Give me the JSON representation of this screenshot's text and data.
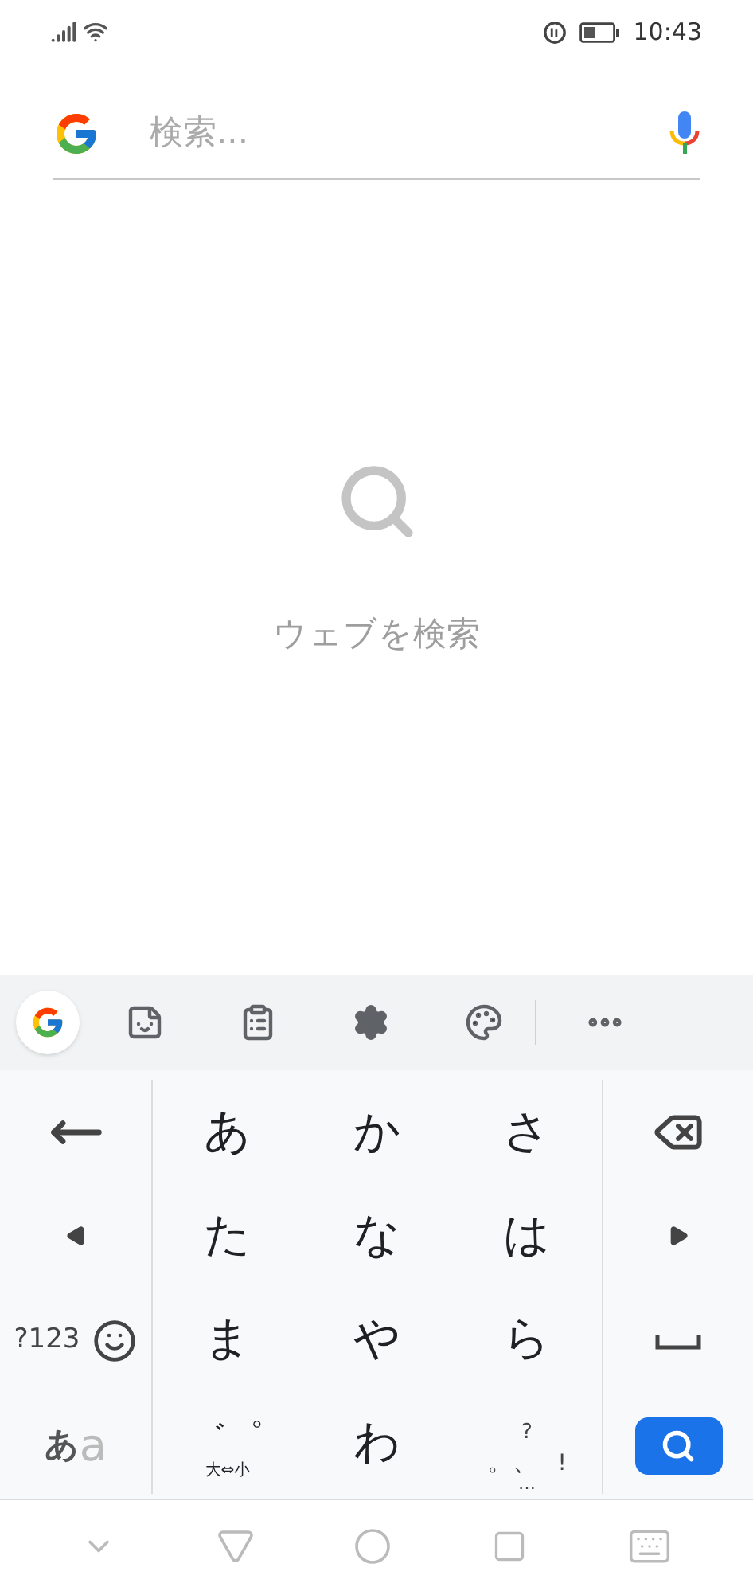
{
  "status_bar": {
    "time": "10:43"
  },
  "search": {
    "placeholder": "検索..."
  },
  "empty_state": {
    "text": "ウェブを検索"
  },
  "keyboard": {
    "symbols_key": "?123",
    "mode_key": {
      "primary": "あ",
      "secondary": "a"
    },
    "keys": [
      {
        "kind": "kana",
        "label": "あ"
      },
      {
        "kind": "kana",
        "label": "か"
      },
      {
        "kind": "kana",
        "label": "さ"
      },
      {
        "kind": "kana",
        "label": "た"
      },
      {
        "kind": "kana",
        "label": "な"
      },
      {
        "kind": "kana",
        "label": "は"
      },
      {
        "kind": "kana",
        "label": "ま"
      },
      {
        "kind": "kana",
        "label": "や"
      },
      {
        "kind": "kana",
        "label": "ら"
      },
      {
        "kind": "dakuten",
        "marks": "゛゜",
        "caption": "大⇔小"
      },
      {
        "kind": "kana",
        "label": "わ"
      },
      {
        "kind": "punctuation",
        "top": "?",
        "middle": "。、",
        "right": "!",
        "bottom": "…"
      }
    ]
  }
}
